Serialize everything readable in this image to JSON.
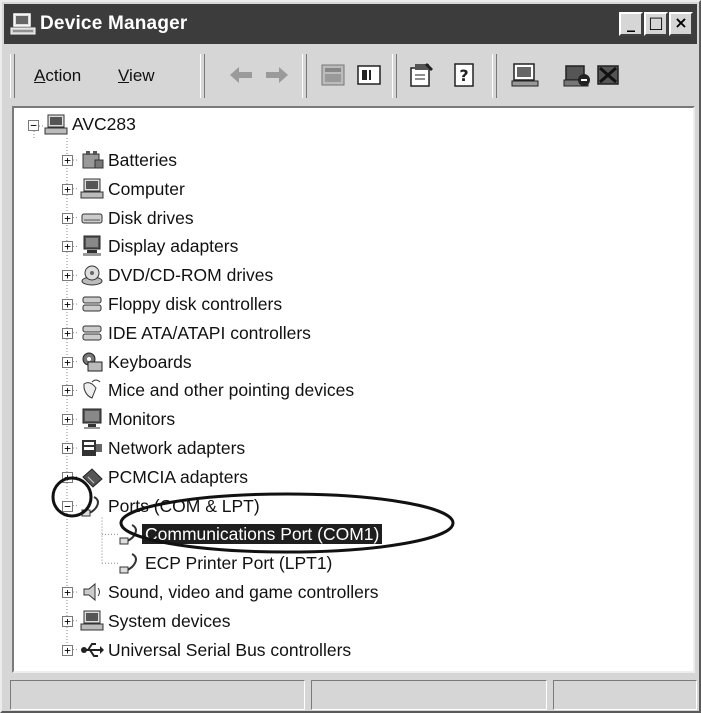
{
  "window": {
    "title": "Device Manager"
  },
  "title_buttons": [
    "_",
    "□",
    "×"
  ],
  "menu": [
    {
      "label_ul": "A",
      "label_rest": "ction"
    },
    {
      "label_ul": "V",
      "label_rest": "iew"
    }
  ],
  "toolbar_icons": [
    "back-arrow-icon",
    "forward-arrow-icon",
    "properties-page-icon",
    "show-hide-tree-icon",
    "properties-icon",
    "help-icon",
    "scan-hardware-icon",
    "disable-device-icon",
    "uninstall-device-icon"
  ],
  "tree": {
    "root": "AVC283",
    "categories": [
      {
        "label": "Batteries",
        "icon": "battery-icon"
      },
      {
        "label": "Computer",
        "icon": "computer-icon"
      },
      {
        "label": "Disk drives",
        "icon": "disk-drive-icon"
      },
      {
        "label": "Display adapters",
        "icon": "display-adapter-icon"
      },
      {
        "label": "DVD/CD-ROM drives",
        "icon": "cd-rom-icon"
      },
      {
        "label": "Floppy disk controllers",
        "icon": "floppy-controller-icon"
      },
      {
        "label": "IDE ATA/ATAPI controllers",
        "icon": "ide-controller-icon"
      },
      {
        "label": "Keyboards",
        "icon": "keyboard-icon"
      },
      {
        "label": "Mice and other pointing devices",
        "icon": "mouse-icon"
      },
      {
        "label": "Monitors",
        "icon": "monitor-icon"
      },
      {
        "label": "Network adapters",
        "icon": "network-adapter-icon"
      },
      {
        "label": "PCMCIA adapters",
        "icon": "pcmcia-icon"
      },
      {
        "label": "Ports (COM & LPT)",
        "icon": "port-icon",
        "expanded": true,
        "children": [
          {
            "label": "Communications Port (COM1)",
            "icon": "port-icon",
            "selected": true
          },
          {
            "label": "ECP Printer Port (LPT1)",
            "icon": "port-icon"
          }
        ]
      },
      {
        "label": "Sound, video and game controllers",
        "icon": "speaker-icon"
      },
      {
        "label": "System devices",
        "icon": "system-device-icon"
      },
      {
        "label": "Universal Serial Bus controllers",
        "icon": "usb-icon"
      }
    ]
  },
  "colors": {
    "title_bg": "#3c3c3c",
    "selection_bg": "#1e1e1e",
    "window_bg": "#d6d6d6"
  }
}
